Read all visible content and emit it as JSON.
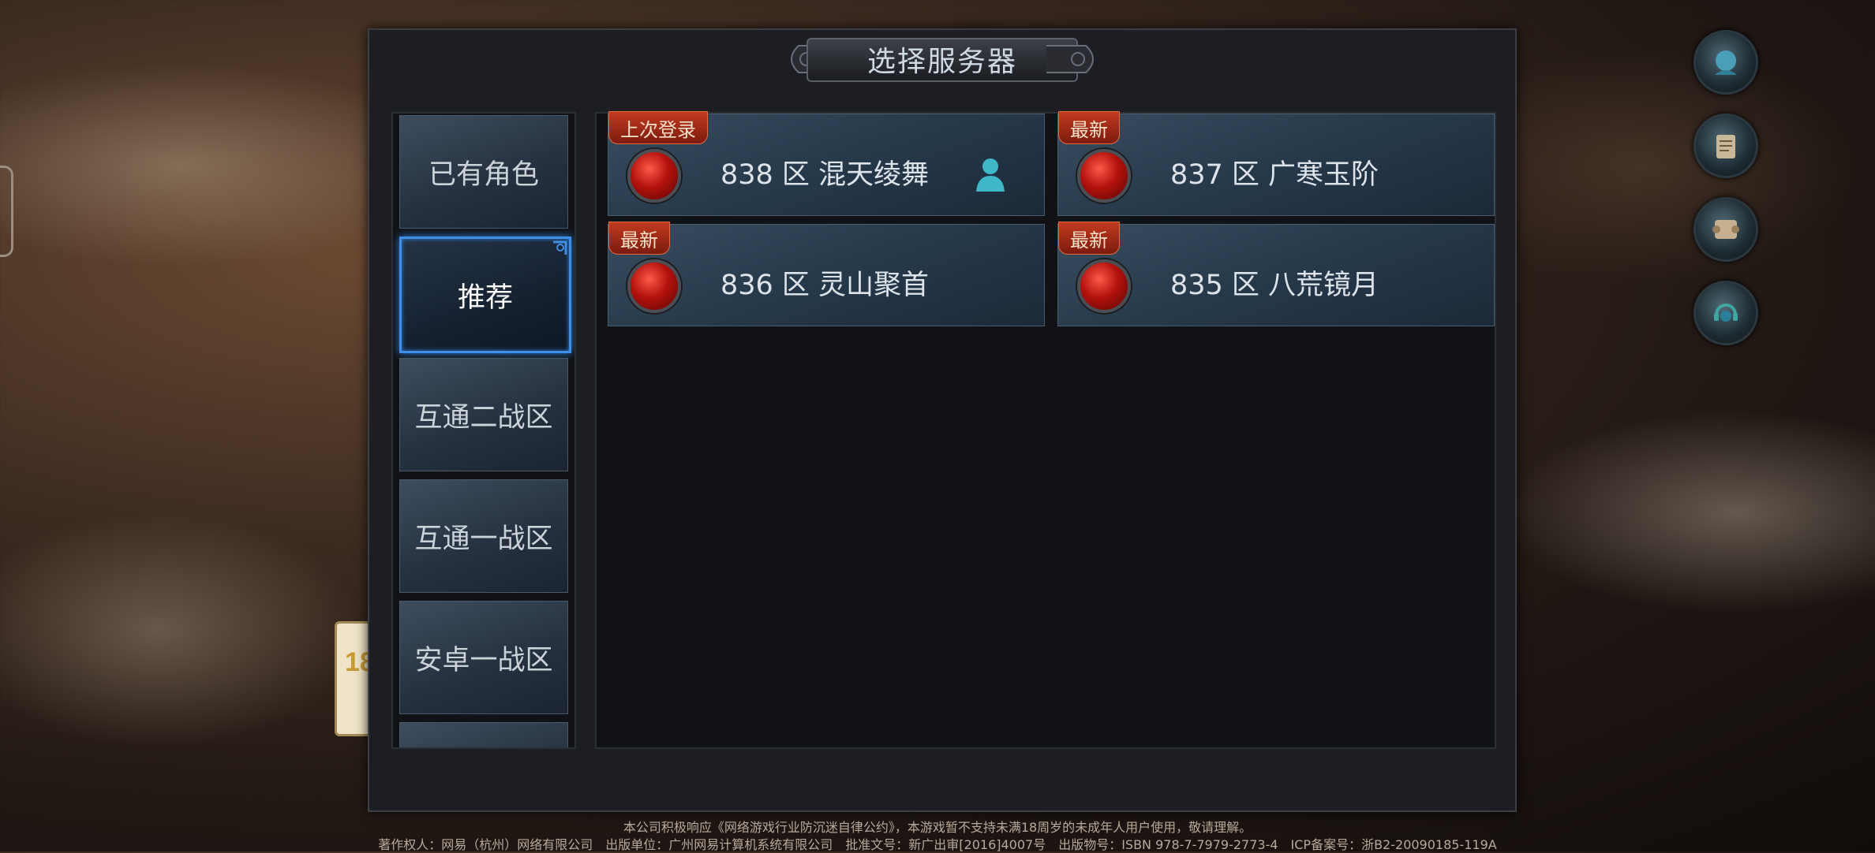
{
  "dialog": {
    "title": "选择服务器"
  },
  "tabs": [
    {
      "label": "已有角色",
      "active": false
    },
    {
      "label": "推荐",
      "active": true
    },
    {
      "label": "互通二战区",
      "active": false
    },
    {
      "label": "互通一战区",
      "active": false
    },
    {
      "label": "安卓一战区",
      "active": false
    }
  ],
  "servers": [
    {
      "badge": "上次登录",
      "name": "838 区 混天绫舞",
      "has_role": true,
      "status_color": "#d21a12"
    },
    {
      "badge": "最新",
      "name": "837 区 广寒玉阶",
      "has_role": false,
      "status_color": "#d21a12"
    },
    {
      "badge": "最新",
      "name": "836 区 灵山聚首",
      "has_role": false,
      "status_color": "#d21a12"
    },
    {
      "badge": "最新",
      "name": "835 区 八荒镜月",
      "has_role": false,
      "status_color": "#d21a12"
    }
  ],
  "age_badge": {
    "text": "18"
  },
  "side_icons": [
    "account-icon",
    "notice-scroll-icon",
    "scroll-icon",
    "customer-service-icon"
  ],
  "footer": {
    "line1": "本公司积极响应《网络游戏行业防沉迷自律公约》，本游戏暂不支持未满18周岁的未成年人用户使用，敬请理解。",
    "line2": "著作权人：网易（杭州）网络有限公司　出版单位：广州网易计算机系统有限公司　批准文号：新广出审[2016]4007号　出版物号：ISBN 978-7-7979-2773-4　ICP备案号：浙B2-20090185-119A"
  },
  "colors": {
    "accent_blue": "#3f8fe8",
    "badge_red": "#c23a1e",
    "role_icon": "#3fb7c9"
  }
}
